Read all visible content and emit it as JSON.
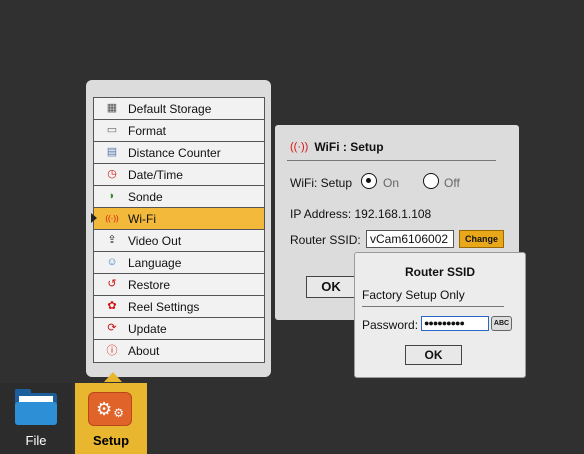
{
  "menu": {
    "items": [
      {
        "label": "Default Storage",
        "icon": "storage-icon",
        "glyph": "▦",
        "color": "#555555"
      },
      {
        "label": "Format",
        "icon": "format-icon",
        "glyph": "▭",
        "color": "#666666"
      },
      {
        "label": "Distance Counter",
        "icon": "distance-counter-icon",
        "glyph": "▤",
        "color": "#5577aa"
      },
      {
        "label": "Date/Time",
        "icon": "clock-icon",
        "glyph": "◷",
        "color": "#cc1111"
      },
      {
        "label": "Sonde",
        "icon": "sonde-icon",
        "glyph": "◗",
        "color": "#3a8a2a"
      },
      {
        "label": "Wi-Fi",
        "icon": "wifi-icon",
        "glyph": "((·))",
        "color": "#d11111"
      },
      {
        "label": "Video Out",
        "icon": "video-out-icon",
        "glyph": "⇪",
        "color": "#222222"
      },
      {
        "label": "Language",
        "icon": "language-icon",
        "glyph": "☺",
        "color": "#3b7bd0"
      },
      {
        "label": "Restore",
        "icon": "restore-icon",
        "glyph": "↺",
        "color": "#cc1111"
      },
      {
        "label": "Reel Settings",
        "icon": "reel-settings-icon",
        "glyph": "✿",
        "color": "#cc1111"
      },
      {
        "label": "Update",
        "icon": "update-icon",
        "glyph": "⟳",
        "color": "#cc1111"
      },
      {
        "label": "About",
        "icon": "about-icon",
        "glyph": "ⓘ",
        "color": "#cc1111"
      }
    ],
    "selected_index": 5
  },
  "dock": {
    "file_label": "File",
    "setup_label": "Setup"
  },
  "wifi": {
    "title": "WiFi : Setup",
    "setup_label": "WiFi: Setup",
    "on_label": "On",
    "off_label": "Off",
    "selected": "On",
    "ip_text": "IP Address: 192.168.1.108",
    "ssid_label": "Router SSID:",
    "ssid_value": "vCam6106002",
    "change_label": "Change",
    "ok_label": "OK"
  },
  "router_dialog": {
    "title": "Router SSID",
    "subtitle": "Factory Setup Only",
    "password_label": "Password:",
    "password_value": "●●●●●●●●●",
    "abc_label": "ABC",
    "ok_label": "OK"
  },
  "colors": {
    "background": "#303030",
    "accent": "#f2b93b",
    "panel": "#dcdcdc"
  }
}
